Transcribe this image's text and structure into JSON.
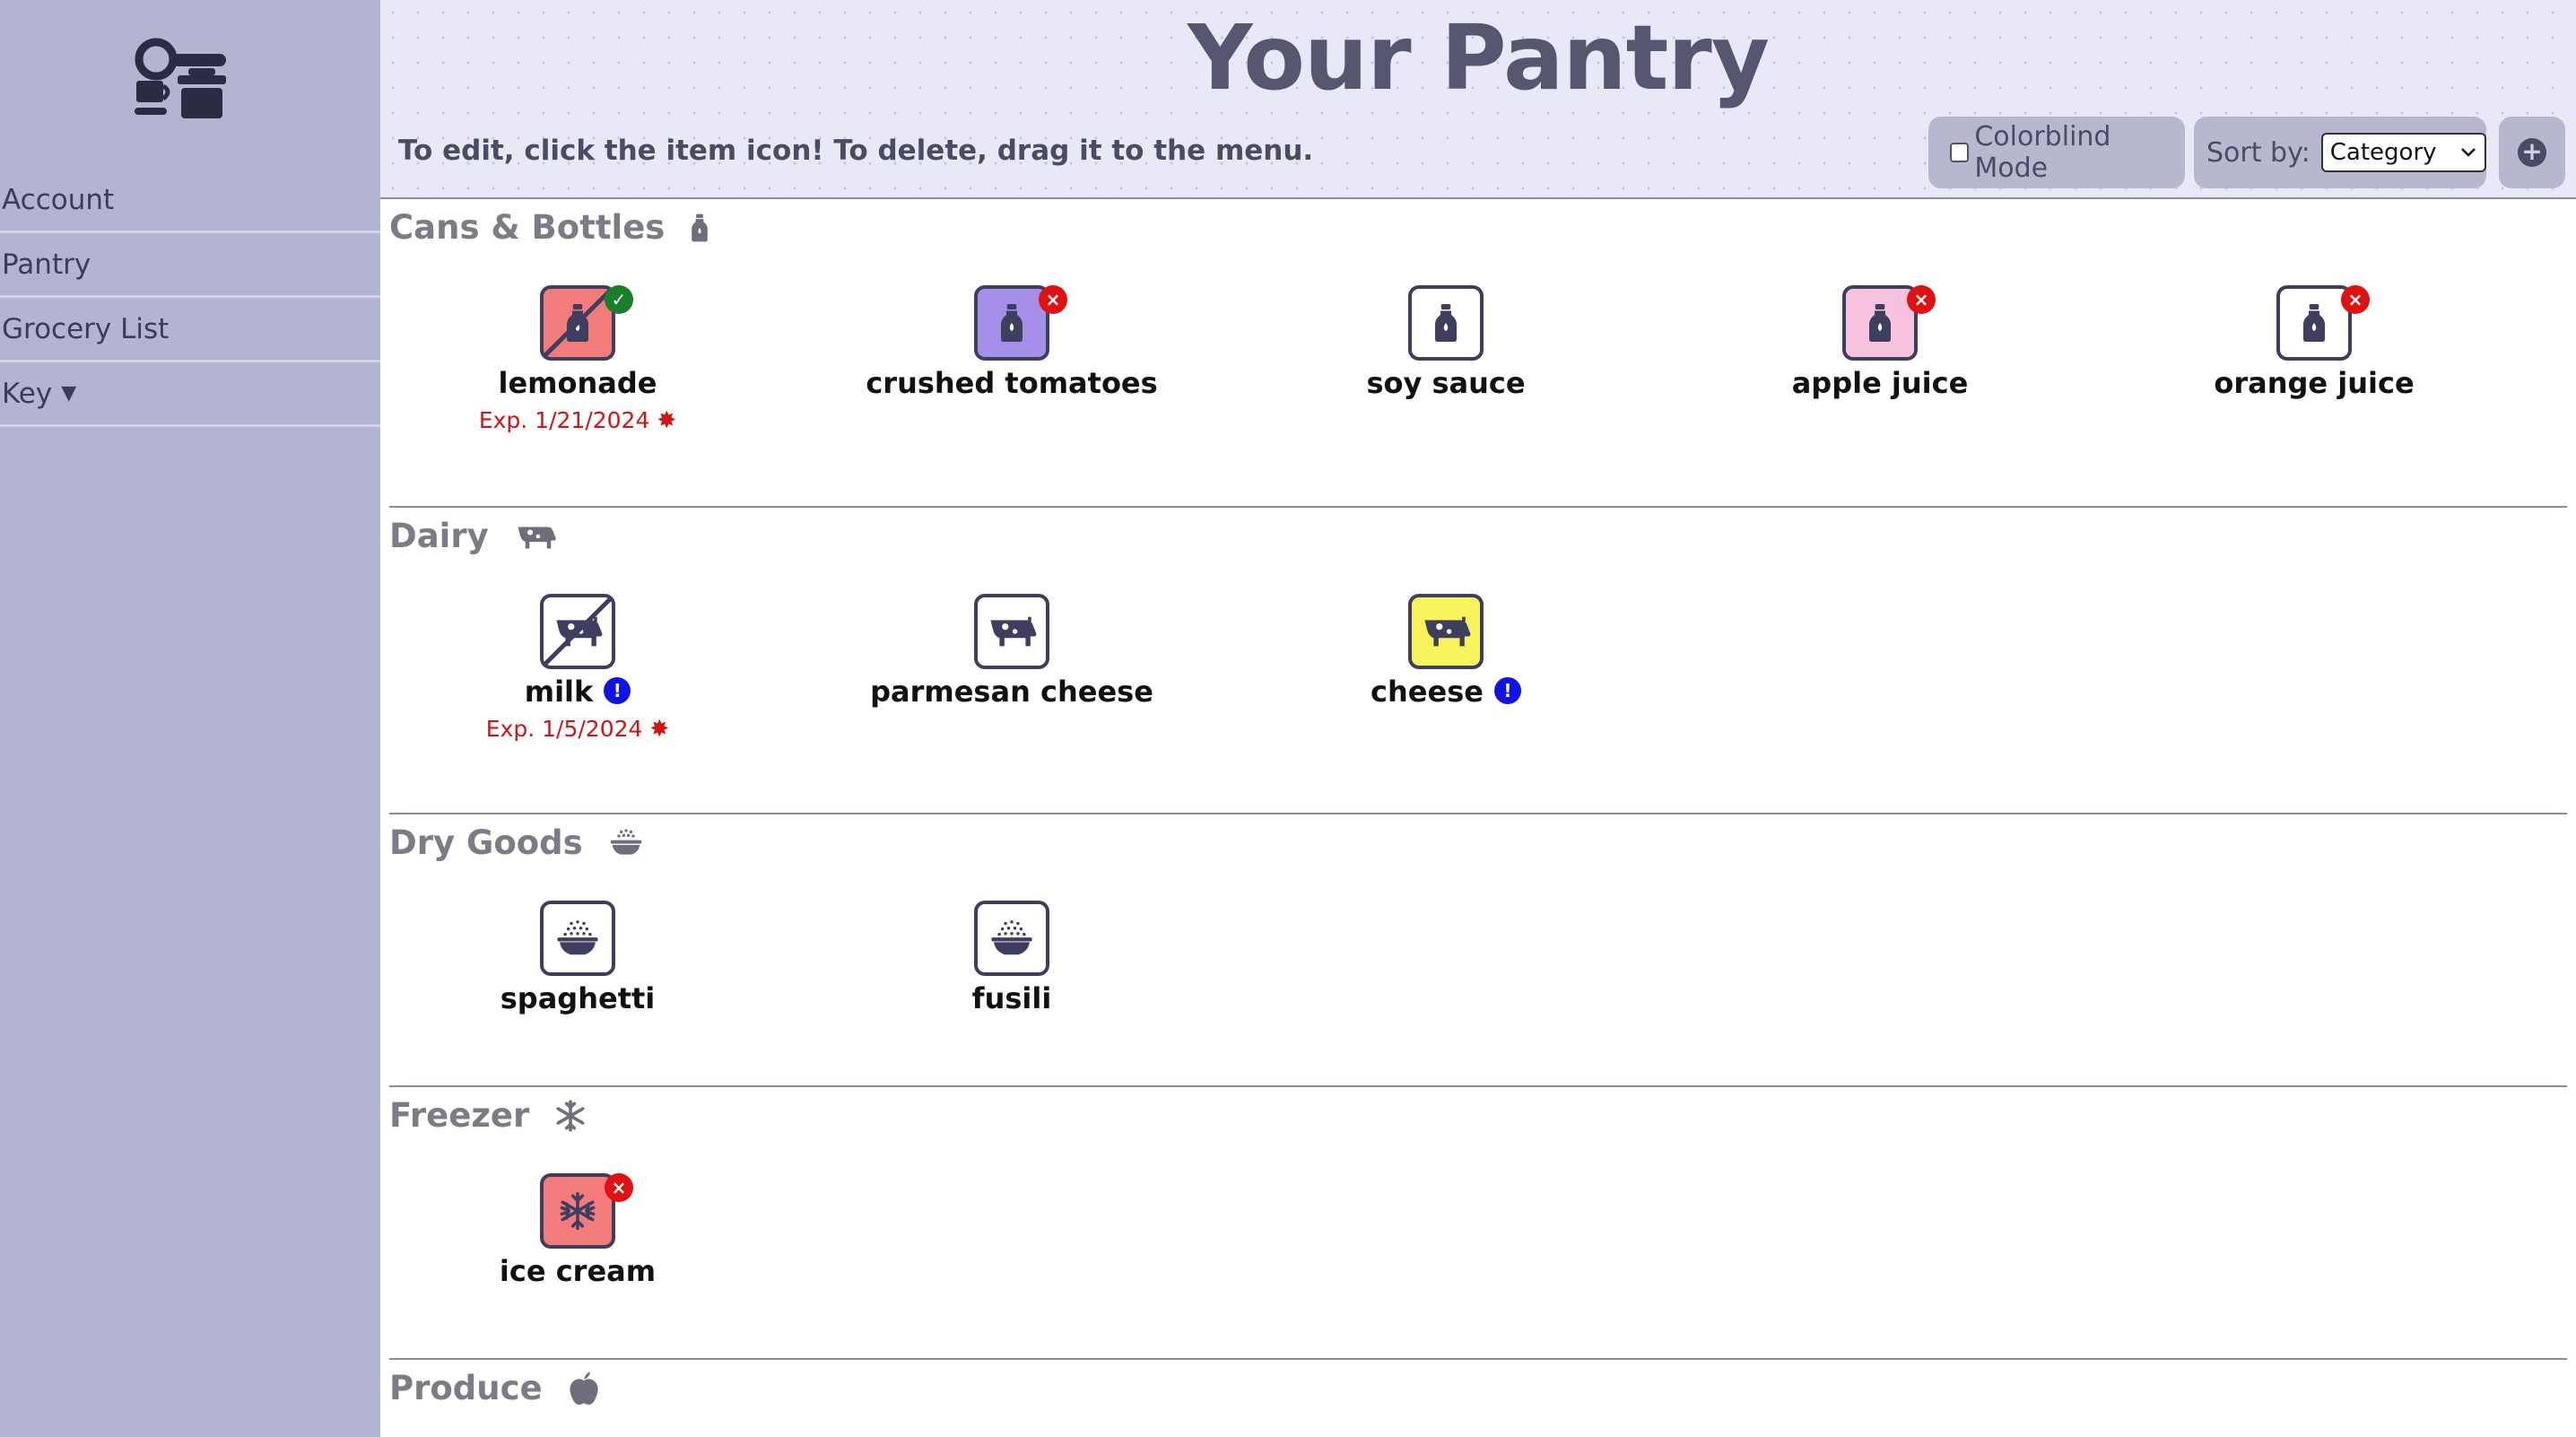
{
  "sidebar": {
    "items": [
      {
        "label": "Account"
      },
      {
        "label": "Pantry"
      },
      {
        "label": "Grocery List"
      },
      {
        "label": "Key"
      }
    ]
  },
  "header": {
    "title": "Your Pantry",
    "hint": "To edit, click the item icon! To delete, drag it to the menu.",
    "colorblind_label": "Colorblind Mode",
    "colorblind_checked": false,
    "sort_label": "Sort by:",
    "sort_value": "Category"
  },
  "sections": [
    {
      "title": "Cans & Bottles",
      "icon": "bottle-icon",
      "items": [
        {
          "name": "lemonade",
          "icon": "bottle-icon",
          "color": "#f27c7c",
          "crossed": true,
          "badge": "check",
          "expiry": "Exp. 1/21/2024"
        },
        {
          "name": "crushed tomatoes",
          "icon": "bottle-icon",
          "color": "#a68fe8",
          "badge": "x"
        },
        {
          "name": "soy sauce",
          "icon": "bottle-icon",
          "color": "#ffffff"
        },
        {
          "name": "apple juice",
          "icon": "bottle-icon",
          "color": "#f7c3df",
          "badge": "x"
        },
        {
          "name": "orange juice",
          "icon": "bottle-icon",
          "color": "#ffffff",
          "badge": "x"
        }
      ]
    },
    {
      "title": "Dairy",
      "icon": "cow-icon",
      "items": [
        {
          "name": "milk",
          "icon": "cow-icon",
          "color": "#ffffff",
          "crossed": true,
          "info": true,
          "expiry": "Exp. 1/5/2024"
        },
        {
          "name": "parmesan cheese",
          "icon": "cow-icon",
          "color": "#ffffff"
        },
        {
          "name": "cheese",
          "icon": "cow-icon",
          "color": "#f7f35a",
          "info": true
        }
      ]
    },
    {
      "title": "Dry Goods",
      "icon": "bowl-icon",
      "items": [
        {
          "name": "spaghetti",
          "icon": "bowl-icon",
          "color": "#ffffff"
        },
        {
          "name": "fusili",
          "icon": "bowl-icon",
          "color": "#ffffff"
        }
      ]
    },
    {
      "title": "Freezer",
      "icon": "snowflake-icon",
      "items": [
        {
          "name": "ice cream",
          "icon": "snowflake-icon",
          "color": "#f27c7c",
          "badge": "x"
        }
      ]
    },
    {
      "title": "Produce",
      "icon": "apple-icon",
      "items": []
    }
  ]
}
